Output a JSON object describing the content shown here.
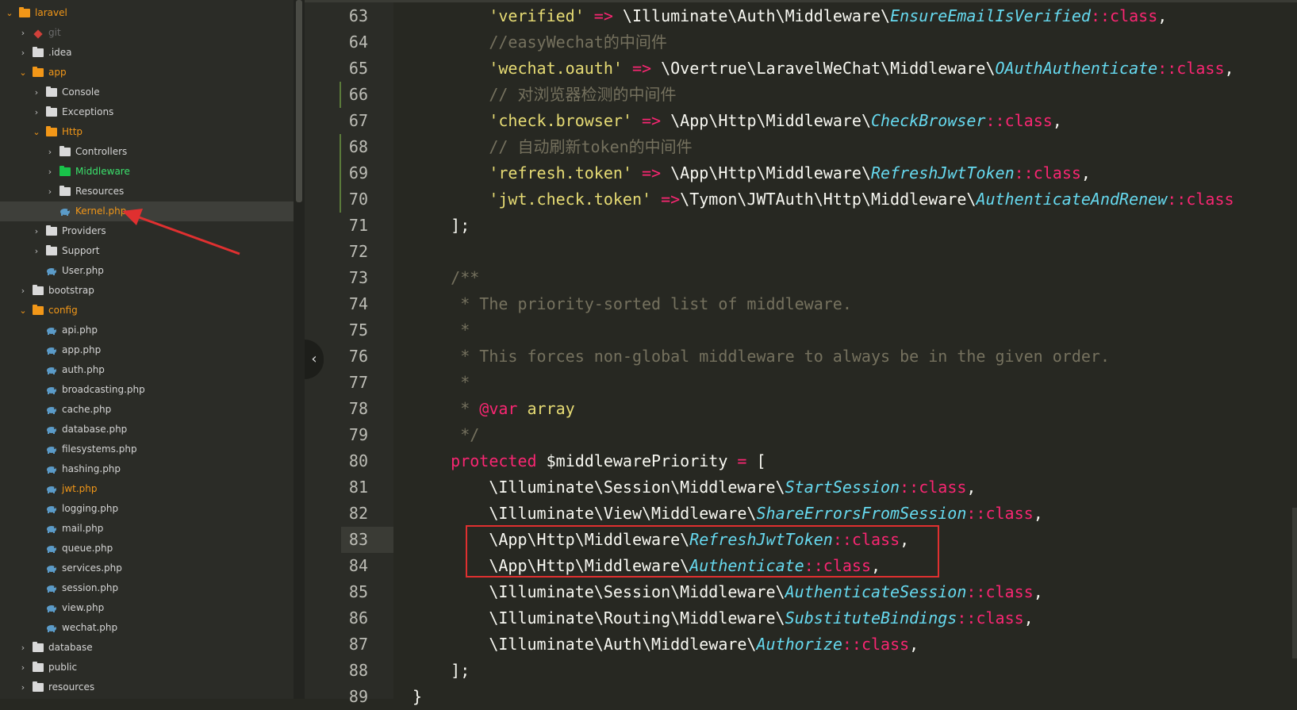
{
  "sidebar": {
    "items": [
      {
        "label": "laravel",
        "depth": 0,
        "type": "project",
        "open": true
      },
      {
        "label": "git",
        "depth": 1,
        "type": "git",
        "open": false
      },
      {
        "label": ".idea",
        "depth": 1,
        "type": "folder",
        "open": false
      },
      {
        "label": "app",
        "depth": 1,
        "type": "folder",
        "open": true,
        "color": "orange"
      },
      {
        "label": "Console",
        "depth": 2,
        "type": "folder",
        "open": false
      },
      {
        "label": "Exceptions",
        "depth": 2,
        "type": "folder",
        "open": false
      },
      {
        "label": "Http",
        "depth": 2,
        "type": "folder",
        "open": true,
        "color": "orange"
      },
      {
        "label": "Controllers",
        "depth": 3,
        "type": "folder",
        "open": false
      },
      {
        "label": "Middleware",
        "depth": 3,
        "type": "folder",
        "open": false,
        "color": "green"
      },
      {
        "label": "Resources",
        "depth": 3,
        "type": "folder",
        "open": false
      },
      {
        "label": "Kernel.php",
        "depth": 3,
        "type": "php",
        "selected": true,
        "color": "orange"
      },
      {
        "label": "Providers",
        "depth": 2,
        "type": "folder",
        "open": false
      },
      {
        "label": "Support",
        "depth": 2,
        "type": "folder",
        "open": false
      },
      {
        "label": "User.php",
        "depth": 2,
        "type": "php"
      },
      {
        "label": "bootstrap",
        "depth": 1,
        "type": "folder",
        "open": false
      },
      {
        "label": "config",
        "depth": 1,
        "type": "folder",
        "open": true,
        "color": "orange"
      },
      {
        "label": "api.php",
        "depth": 2,
        "type": "php"
      },
      {
        "label": "app.php",
        "depth": 2,
        "type": "php"
      },
      {
        "label": "auth.php",
        "depth": 2,
        "type": "php"
      },
      {
        "label": "broadcasting.php",
        "depth": 2,
        "type": "php"
      },
      {
        "label": "cache.php",
        "depth": 2,
        "type": "php"
      },
      {
        "label": "database.php",
        "depth": 2,
        "type": "php"
      },
      {
        "label": "filesystems.php",
        "depth": 2,
        "type": "php"
      },
      {
        "label": "hashing.php",
        "depth": 2,
        "type": "php"
      },
      {
        "label": "jwt.php",
        "depth": 2,
        "type": "php",
        "color": "orange"
      },
      {
        "label": "logging.php",
        "depth": 2,
        "type": "php"
      },
      {
        "label": "mail.php",
        "depth": 2,
        "type": "php"
      },
      {
        "label": "queue.php",
        "depth": 2,
        "type": "php"
      },
      {
        "label": "services.php",
        "depth": 2,
        "type": "php"
      },
      {
        "label": "session.php",
        "depth": 2,
        "type": "php"
      },
      {
        "label": "view.php",
        "depth": 2,
        "type": "php"
      },
      {
        "label": "wechat.php",
        "depth": 2,
        "type": "php"
      },
      {
        "label": "database",
        "depth": 1,
        "type": "folder",
        "open": false
      },
      {
        "label": "public",
        "depth": 1,
        "type": "folder",
        "open": false
      },
      {
        "label": "resources",
        "depth": 1,
        "type": "folder",
        "open": false
      }
    ]
  },
  "editor": {
    "current_line": 83,
    "modified_lines": [
      66,
      68,
      69,
      70
    ],
    "highlight_lines": [
      83,
      84
    ],
    "lines": [
      {
        "n": "63",
        "tokens": [
          [
            "        ",
            ""
          ],
          [
            "'verified'",
            "str"
          ],
          [
            " => ",
            "op"
          ],
          [
            "\\Illuminate\\Auth\\Middleware\\",
            ""
          ],
          [
            "EnsureEmailIsVerified",
            "cls"
          ],
          [
            "::class",
            "op"
          ],
          [
            ",",
            ""
          ]
        ]
      },
      {
        "n": "64",
        "tokens": [
          [
            "        ",
            ""
          ],
          [
            "//easyWechat的中间件",
            "cmt"
          ]
        ]
      },
      {
        "n": "65",
        "tokens": [
          [
            "        ",
            ""
          ],
          [
            "'wechat.oauth'",
            "str"
          ],
          [
            " => ",
            "op"
          ],
          [
            "\\Overtrue\\LaravelWeChat\\Middleware\\",
            ""
          ],
          [
            "OAuthAuthenticate",
            "cls"
          ],
          [
            "::class",
            "op"
          ],
          [
            ",",
            ""
          ]
        ]
      },
      {
        "n": "66",
        "tokens": [
          [
            "        ",
            ""
          ],
          [
            "// 对浏览器检测的中间件",
            "cmt"
          ]
        ]
      },
      {
        "n": "67",
        "tokens": [
          [
            "        ",
            ""
          ],
          [
            "'check.browser'",
            "str"
          ],
          [
            " => ",
            "op"
          ],
          [
            "\\App\\Http\\Middleware\\",
            ""
          ],
          [
            "CheckBrowser",
            "cls"
          ],
          [
            "::class",
            "op"
          ],
          [
            ",",
            ""
          ]
        ]
      },
      {
        "n": "68",
        "tokens": [
          [
            "        ",
            ""
          ],
          [
            "// 自动刷新token的中间件",
            "cmt"
          ]
        ]
      },
      {
        "n": "69",
        "tokens": [
          [
            "        ",
            ""
          ],
          [
            "'refresh.token'",
            "str"
          ],
          [
            " => ",
            "op"
          ],
          [
            "\\App\\Http\\Middleware\\",
            ""
          ],
          [
            "RefreshJwtToken",
            "cls"
          ],
          [
            "::class",
            "op"
          ],
          [
            ",",
            ""
          ]
        ]
      },
      {
        "n": "70",
        "tokens": [
          [
            "        ",
            ""
          ],
          [
            "'jwt.check.token'",
            "str"
          ],
          [
            " =>",
            "op"
          ],
          [
            "\\Tymon\\JWTAuth\\Http\\Middleware\\",
            ""
          ],
          [
            "AuthenticateAndRenew",
            "cls"
          ],
          [
            "::class",
            "op"
          ]
        ]
      },
      {
        "n": "71",
        "tokens": [
          [
            "    ];",
            ""
          ]
        ]
      },
      {
        "n": "72",
        "tokens": [
          [
            "",
            ""
          ]
        ]
      },
      {
        "n": "73",
        "tokens": [
          [
            "    /**",
            "cmt"
          ]
        ]
      },
      {
        "n": "74",
        "tokens": [
          [
            "     * The priority-sorted list of middleware.",
            "cmt"
          ]
        ]
      },
      {
        "n": "75",
        "tokens": [
          [
            "     *",
            "cmt"
          ]
        ]
      },
      {
        "n": "76",
        "tokens": [
          [
            "     * This forces non-global middleware to always be in the given order.",
            "cmt"
          ]
        ]
      },
      {
        "n": "77",
        "tokens": [
          [
            "     *",
            "cmt"
          ]
        ]
      },
      {
        "n": "78",
        "tokens": [
          [
            "     * ",
            "cmt"
          ],
          [
            "@var",
            "ann"
          ],
          [
            " array",
            "type"
          ]
        ]
      },
      {
        "n": "79",
        "tokens": [
          [
            "     */",
            "cmt"
          ]
        ]
      },
      {
        "n": "80",
        "tokens": [
          [
            "    ",
            ""
          ],
          [
            "protected",
            "kw"
          ],
          [
            " $middlewarePriority ",
            ""
          ],
          [
            "=",
            "op"
          ],
          [
            " [",
            ""
          ]
        ]
      },
      {
        "n": "81",
        "tokens": [
          [
            "        \\Illuminate\\Session\\Middleware\\",
            ""
          ],
          [
            "StartSession",
            "cls"
          ],
          [
            "::class",
            "op"
          ],
          [
            ",",
            ""
          ]
        ]
      },
      {
        "n": "82",
        "tokens": [
          [
            "        \\Illuminate\\View\\Middleware\\",
            ""
          ],
          [
            "ShareErrorsFromSession",
            "cls"
          ],
          [
            "::class",
            "op"
          ],
          [
            ",",
            ""
          ]
        ]
      },
      {
        "n": "83",
        "tokens": [
          [
            "        \\App\\Http\\Middleware\\",
            ""
          ],
          [
            "RefreshJwtToken",
            "cls"
          ],
          [
            "::class",
            "op"
          ],
          [
            ",",
            ""
          ]
        ]
      },
      {
        "n": "84",
        "tokens": [
          [
            "        \\App\\Http\\Middleware\\",
            ""
          ],
          [
            "Authenticate",
            "cls"
          ],
          [
            "::class",
            "op"
          ],
          [
            ",",
            ""
          ]
        ]
      },
      {
        "n": "85",
        "tokens": [
          [
            "        \\Illuminate\\Session\\Middleware\\",
            ""
          ],
          [
            "AuthenticateSession",
            "cls"
          ],
          [
            "::class",
            "op"
          ],
          [
            ",",
            ""
          ]
        ]
      },
      {
        "n": "86",
        "tokens": [
          [
            "        \\Illuminate\\Routing\\Middleware\\",
            ""
          ],
          [
            "SubstituteBindings",
            "cls"
          ],
          [
            "::class",
            "op"
          ],
          [
            ",",
            ""
          ]
        ]
      },
      {
        "n": "87",
        "tokens": [
          [
            "        \\Illuminate\\Auth\\Middleware\\",
            ""
          ],
          [
            "Authorize",
            "cls"
          ],
          [
            "::class",
            "op"
          ],
          [
            ",",
            ""
          ]
        ]
      },
      {
        "n": "88",
        "tokens": [
          [
            "    ];",
            ""
          ]
        ]
      },
      {
        "n": "89",
        "tokens": [
          [
            "}",
            ""
          ]
        ]
      }
    ]
  },
  "colors": {
    "background": "#272822",
    "accent_orange": "#f29718",
    "accent_green": "#3be06c",
    "highlight_border": "#e03030"
  }
}
